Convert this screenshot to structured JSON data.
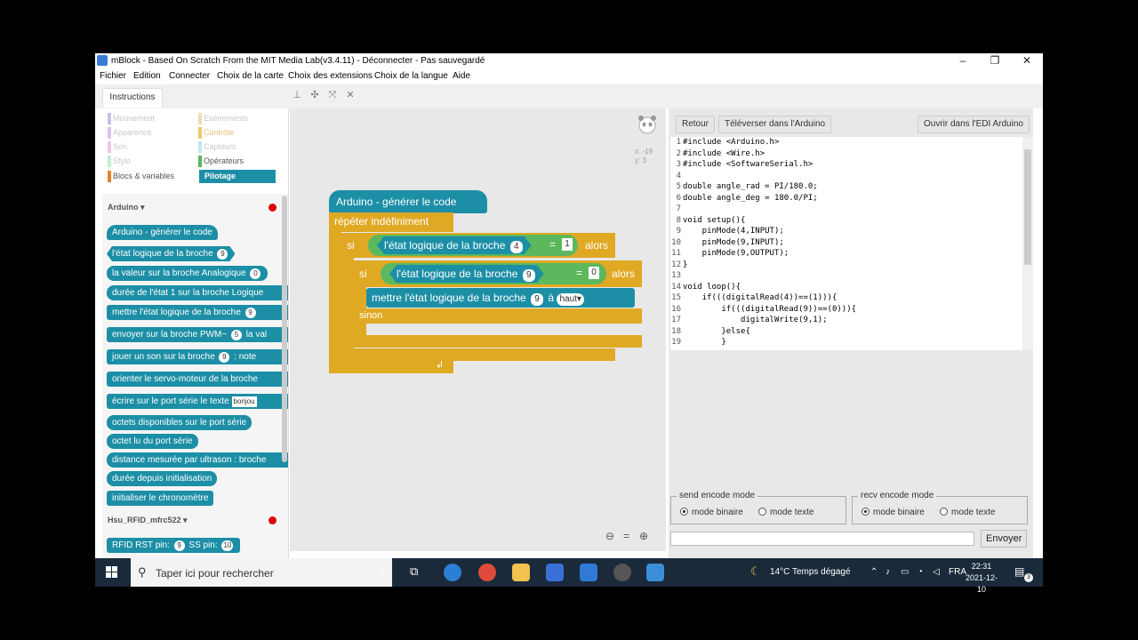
{
  "window": {
    "title": "mBlock - Based On Scratch From the MIT Media Lab(v3.4.11) - Déconnecter - Pas sauvegardé",
    "minimize": "–",
    "maximize": "❐",
    "close": "✕"
  },
  "menu": [
    "Fichier",
    "Edition",
    "Connecter",
    "Choix de la carte",
    "Choix des extensions",
    "Choix de la langue",
    "Aide"
  ],
  "tab": "Instructions",
  "categories": {
    "mouvement": "Mouvement",
    "evenements": "Evénements",
    "apparence": "Apparence",
    "controle": "Contrôle",
    "son": "Son",
    "capteurs": "Capteurs",
    "stylo": "Stylo",
    "operateurs": "Opérateurs",
    "blocs": "Blocs & variables",
    "pilotage": "Pilotage"
  },
  "palette": {
    "arduino_header": "Arduino ▾",
    "rfid_header": "Hsu_RFID_mfrc522 ▾",
    "b_gen": "Arduino - générer le code",
    "b_digital": "l'état logique de la broche",
    "b_digital_n": "9",
    "b_analog": "la valeur sur la broche Analogique",
    "b_analog_n": "0",
    "b_duree": "durée de l'état 1 sur la broche Logique",
    "b_mettre": "mettre l'état logique de la broche",
    "b_mettre_n": "9",
    "b_pwm": "envoyer sur la broche PWM~",
    "b_pwm_n": "5",
    "b_pwm_tail": "la val",
    "b_son": "jouer un son sur la broche",
    "b_son_n": "9",
    "b_son_tail": ": note",
    "b_servo": "orienter le servo-moteur de la broche",
    "b_serie": "écrire sur le port série le texte",
    "b_serie_txt": "bonjou",
    "b_octets": "octets disponibles sur le port série",
    "b_octet": "octet lu du port série",
    "b_ultra": "distance mesurée par ultrason : broche",
    "b_init": "durée depuis initialisation",
    "b_chrono": "initialiser le chronomètre",
    "b_rfid": "RFID RST pin:",
    "b_rfid_rst": "9",
    "b_rfid_ss_lbl": "SS pin:",
    "b_rfid_ss": "10"
  },
  "script": {
    "coord_x": "x: -19",
    "coord_y": "y: 3",
    "hat": "Arduino - générer le code",
    "forever": "répéter indéfiniment",
    "si1": "si",
    "cond1_text": "l'état logique de la broche",
    "cond1_pin": "4",
    "cond1_eq": "=",
    "cond1_val": "1",
    "alors1": "alors",
    "si2": "si",
    "cond2_text": "l'état logique de la broche",
    "cond2_pin": "9",
    "cond2_eq": "=",
    "cond2_val": "0",
    "alors2": "alors",
    "set_text": "mettre l'état logique de la broche",
    "set_pin": "9",
    "set_a": "à",
    "set_val": "haut▾",
    "sinon": "sinon",
    "loop_arrow": "↲",
    "zoom_out": "⊖",
    "zoom_reset": "=",
    "zoom_in": "⊕"
  },
  "right": {
    "btn_retour": "Retour",
    "btn_televerser": "Téléverser dans l'Arduino",
    "btn_ide": "Ouvrir dans l'EDI Arduino",
    "code": [
      {
        "n": "1",
        "t": "#include <Arduino.h>"
      },
      {
        "n": "2",
        "t": "#include <Wire.h>"
      },
      {
        "n": "3",
        "t": "#include <SoftwareSerial.h>"
      },
      {
        "n": "4",
        "t": ""
      },
      {
        "n": "5",
        "t": "double angle_rad = PI/180.0;"
      },
      {
        "n": "6",
        "t": "double angle_deg = 180.0/PI;"
      },
      {
        "n": "7",
        "t": ""
      },
      {
        "n": "8",
        "t": "void setup(){"
      },
      {
        "n": "9",
        "t": "    pinMode(4,INPUT);"
      },
      {
        "n": "10",
        "t": "    pinMode(9,INPUT);"
      },
      {
        "n": "11",
        "t": "    pinMode(9,OUTPUT);"
      },
      {
        "n": "12",
        "t": "}"
      },
      {
        "n": "13",
        "t": ""
      },
      {
        "n": "14",
        "t": "void loop(){"
      },
      {
        "n": "15",
        "t": "    if(((digitalRead(4))==(1))){"
      },
      {
        "n": "16",
        "t": "        if(((digitalRead(9))==(0))){"
      },
      {
        "n": "17",
        "t": "            digitalWrite(9,1);"
      },
      {
        "n": "18",
        "t": "        }else{"
      },
      {
        "n": "19",
        "t": "        }"
      }
    ],
    "send_legend": "send encode mode",
    "recv_legend": "recv encode mode",
    "mode_binaire": "mode binaire",
    "mode_texte": "mode texte",
    "send_btn": "Envoyer"
  },
  "taskbar": {
    "search_placeholder": "Taper ici pour rechercher",
    "weather": "14°C Temps dégagé",
    "lang": "FRA",
    "time": "22:31",
    "date": "2021-12-10",
    "notif": "3"
  },
  "colors": {
    "pilotage": "#1c8fa6",
    "control": "#e0a924",
    "operator": "#5cb85c"
  }
}
